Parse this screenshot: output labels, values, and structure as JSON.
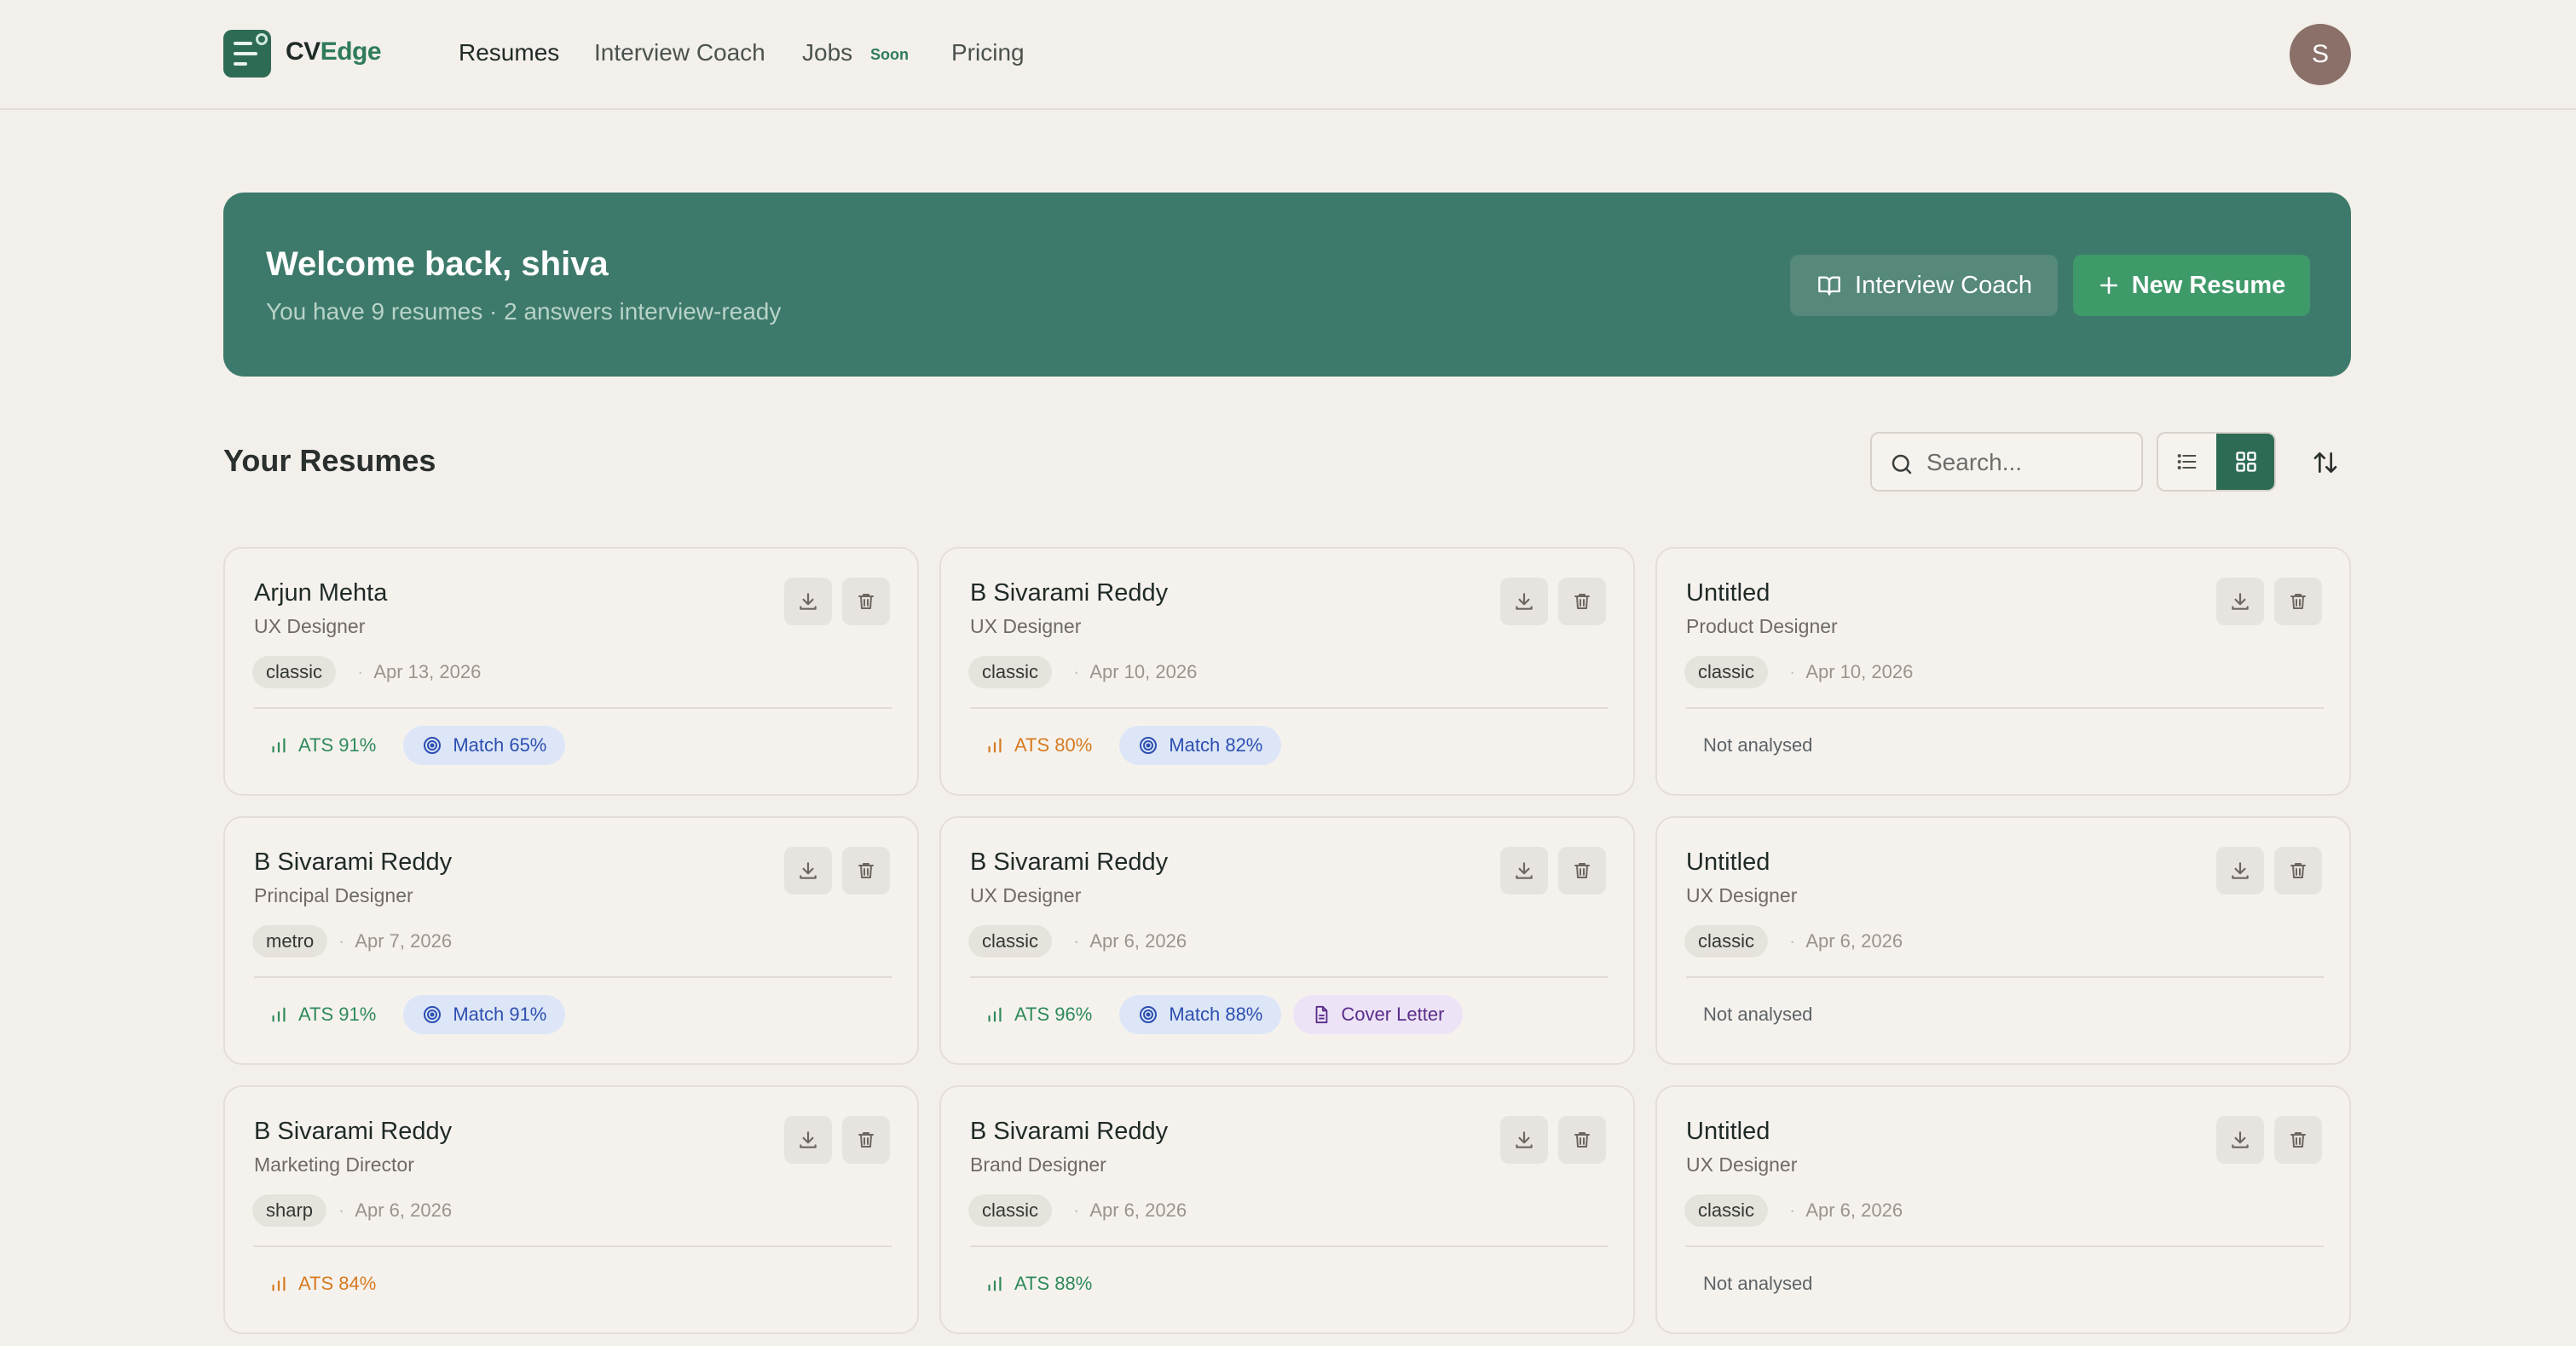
{
  "app": {
    "brand_cv": "CV",
    "brand_edge": "Edge",
    "avatar_initial": "S"
  },
  "nav": {
    "resumes": "Resumes",
    "interview_coach": "Interview Coach",
    "jobs": "Jobs",
    "jobs_badge": "Soon",
    "pricing": "Pricing"
  },
  "banner": {
    "title": "Welcome back, shiva",
    "subtitle": "You have 9 resumes · 2 answers interview-ready",
    "coach_button": "Interview Coach",
    "new_button": "New Resume"
  },
  "section": {
    "title": "Your Resumes",
    "search_placeholder": "Search..."
  },
  "colors": {
    "accent": "#2e6b55",
    "banner": "#3d7a6b",
    "primary_button": "#3f9a6a",
    "ats_good": "#2f8a5a",
    "ats_warn": "#d67a1f",
    "match": "#2c4fb0",
    "cover_letter": "#5a2d8a"
  },
  "cards": [
    {
      "name": "Arjun Mehta",
      "role": "UX Designer",
      "template": "classic",
      "date": "Apr 13, 2026",
      "ats": "ATS 91%",
      "ats_level": "green",
      "match": "Match 65%",
      "cover": null,
      "not_analysed": null
    },
    {
      "name": "B Sivarami Reddy",
      "role": "UX Designer",
      "template": "classic",
      "date": "Apr 10, 2026",
      "ats": "ATS 80%",
      "ats_level": "orange",
      "match": "Match 82%",
      "cover": null,
      "not_analysed": null
    },
    {
      "name": "Untitled",
      "role": "Product Designer",
      "template": "classic",
      "date": "Apr 10, 2026",
      "ats": null,
      "ats_level": null,
      "match": null,
      "cover": null,
      "not_analysed": "Not analysed"
    },
    {
      "name": "B Sivarami Reddy",
      "role": "Principal Designer",
      "template": "metro",
      "date": "Apr 7, 2026",
      "ats": "ATS 91%",
      "ats_level": "green",
      "match": "Match 91%",
      "cover": null,
      "not_analysed": null
    },
    {
      "name": "B Sivarami Reddy",
      "role": "UX Designer",
      "template": "classic",
      "date": "Apr 6, 2026",
      "ats": "ATS 96%",
      "ats_level": "green",
      "match": "Match 88%",
      "cover": "Cover Letter",
      "not_analysed": null
    },
    {
      "name": "Untitled",
      "role": "UX Designer",
      "template": "classic",
      "date": "Apr 6, 2026",
      "ats": null,
      "ats_level": null,
      "match": null,
      "cover": null,
      "not_analysed": "Not analysed"
    },
    {
      "name": "B Sivarami Reddy",
      "role": "Marketing Director",
      "template": "sharp",
      "date": "Apr 6, 2026",
      "ats": "ATS 84%",
      "ats_level": "orange",
      "match": null,
      "cover": null,
      "not_analysed": null
    },
    {
      "name": "B Sivarami Reddy",
      "role": "Brand Designer",
      "template": "classic",
      "date": "Apr 6, 2026",
      "ats": "ATS 88%",
      "ats_level": "green",
      "match": null,
      "cover": null,
      "not_analysed": null
    },
    {
      "name": "Untitled",
      "role": "UX Designer",
      "template": "classic",
      "date": "Apr 6, 2026",
      "ats": null,
      "ats_level": null,
      "match": null,
      "cover": null,
      "not_analysed": "Not analysed"
    }
  ]
}
